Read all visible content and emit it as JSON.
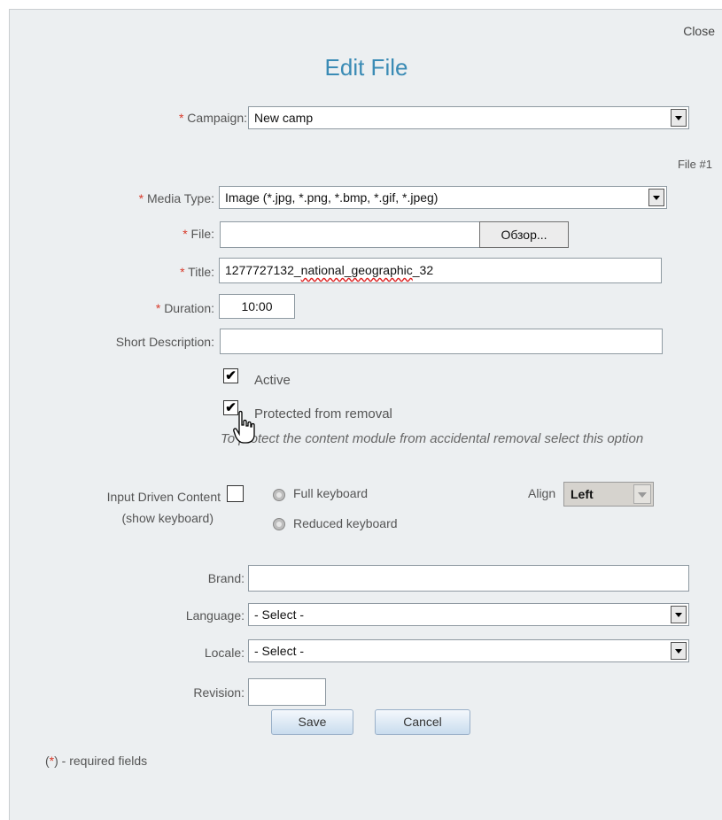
{
  "dialog": {
    "close_label": "Close",
    "title": "Edit File",
    "file_number": "File #1",
    "required_note_prefix": "(",
    "required_note_star": "*",
    "required_note_suffix": ") - required fields"
  },
  "form": {
    "required_mark": "*",
    "campaign": {
      "label": "Campaign:",
      "value": "New camp"
    },
    "media_type": {
      "label": "Media Type:",
      "value": "Image (*.jpg, *.png, *.bmp, *.gif, *.jpeg)"
    },
    "file": {
      "label": "File:",
      "value": "",
      "browse_label": "Обзор..."
    },
    "title": {
      "label": "Title:",
      "value_prefix": "1277727132_",
      "value_misspelled": "national_geographic",
      "value_suffix": "_32"
    },
    "duration": {
      "label": "Duration:",
      "value": "10:00"
    },
    "short_description": {
      "label": "Short Description:",
      "value": ""
    },
    "active": {
      "label": "Active",
      "checked": true,
      "mark": "✔"
    },
    "protected": {
      "label": "Protected from removal",
      "checked": true,
      "mark": "✔",
      "hint": "To protect the content module from accidental removal select this option"
    },
    "input_driven": {
      "label_line1": "Input Driven Content",
      "label_line2": "(show keyboard)",
      "checked": false
    },
    "keyboard_full": {
      "label": "Full keyboard"
    },
    "keyboard_reduced": {
      "label": "Reduced keyboard"
    },
    "align": {
      "label": "Align",
      "value": "Left"
    },
    "brand": {
      "label": "Brand:",
      "value": ""
    },
    "language": {
      "label": "Language:",
      "value": "- Select -"
    },
    "locale": {
      "label": "Locale:",
      "value": "- Select -"
    },
    "revision": {
      "label": "Revision:",
      "value": ""
    }
  },
  "buttons": {
    "save": "Save",
    "cancel": "Cancel"
  },
  "colors": {
    "title": "#3a8bb5",
    "required": "#d83a2a",
    "panel_bg": "#eceff1"
  },
  "icons": {
    "cursor": "mouse-pointer-icon"
  }
}
